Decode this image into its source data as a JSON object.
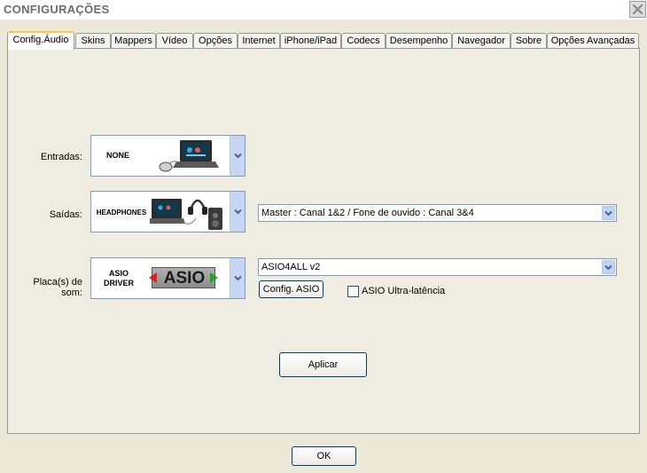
{
  "window": {
    "title": "CONFIGURAÇÕES"
  },
  "tabs": [
    {
      "label": "Config.Áudio",
      "active": true
    },
    {
      "label": "Skins"
    },
    {
      "label": "Mappers"
    },
    {
      "label": "Vídeo"
    },
    {
      "label": "Opções"
    },
    {
      "label": "Internet"
    },
    {
      "label": "iPhone/iPad"
    },
    {
      "label": "Codecs"
    },
    {
      "label": "Desempenho"
    },
    {
      "label": "Navegador"
    },
    {
      "label": "Sobre"
    },
    {
      "label": "Opções Avançadas"
    }
  ],
  "audio": {
    "inputs": {
      "label": "Entradas:",
      "device": "NONE"
    },
    "outputs": {
      "label": "Saídas:",
      "device": "HEADPHONES",
      "routing": "Master : Canal 1&2 / Fone de ouvido : Canal 3&4"
    },
    "soundcard": {
      "label": "Placa(s) de som:",
      "device_line1": "ASIO",
      "device_line2": "DRIVER",
      "logo_text": "ASIO",
      "driver": "ASIO4ALL v2",
      "config_button": "Config. ASIO",
      "ultra_latency_label": "ASIO Ultra-latência",
      "ultra_latency_checked": false
    },
    "apply_button": "Aplicar"
  },
  "footer": {
    "ok_button": "OK"
  },
  "colors": {
    "active_tab_accent": "#FFC83C",
    "dropdown_arrow_bg": "#C1D3FB",
    "button_border": "#003C74"
  }
}
